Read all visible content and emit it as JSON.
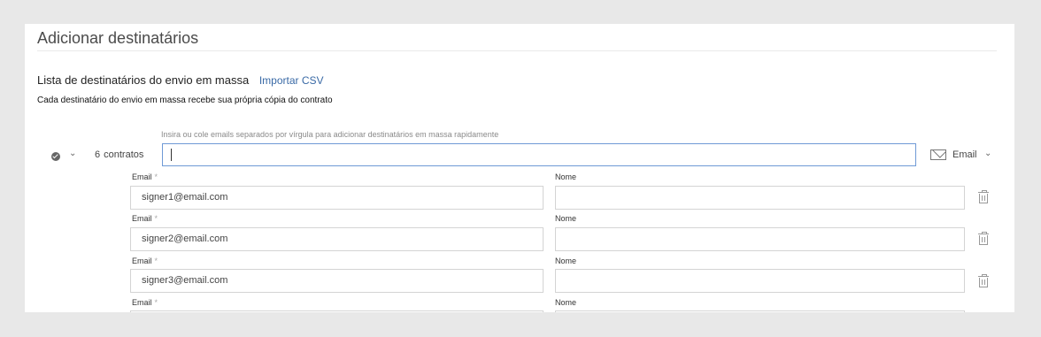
{
  "header": {
    "title": "Adicionar destinatários"
  },
  "bulk_list": {
    "label": "Lista de destinatários do envio em massa",
    "import_link": "Importar CSV",
    "description": "Cada destinatário do envio em massa recebe sua própria cópia do contrato",
    "hint": "Insira ou cole emails separados por vírgula para adicionar destinatários em massa rapidamente",
    "count": "6",
    "count_label": "contratos",
    "input_value": "",
    "delivery_method": "Email"
  },
  "recipients": [
    {
      "email_label": "Email",
      "required": "*",
      "email": "signer1@email.com",
      "name_label": "Nome",
      "name": ""
    },
    {
      "email_label": "Email",
      "required": "*",
      "email": "signer2@email.com",
      "name_label": "Nome",
      "name": ""
    },
    {
      "email_label": "Email",
      "required": "*",
      "email": "signer3@email.com",
      "name_label": "Nome",
      "name": ""
    },
    {
      "email_label": "Email",
      "required": "*",
      "email": "",
      "name_label": "Nome",
      "name": ""
    }
  ],
  "icons": {
    "check": "check-circle-icon",
    "expand": "chevron-down-icon",
    "mail": "envelope-icon",
    "delete": "trash-icon"
  }
}
